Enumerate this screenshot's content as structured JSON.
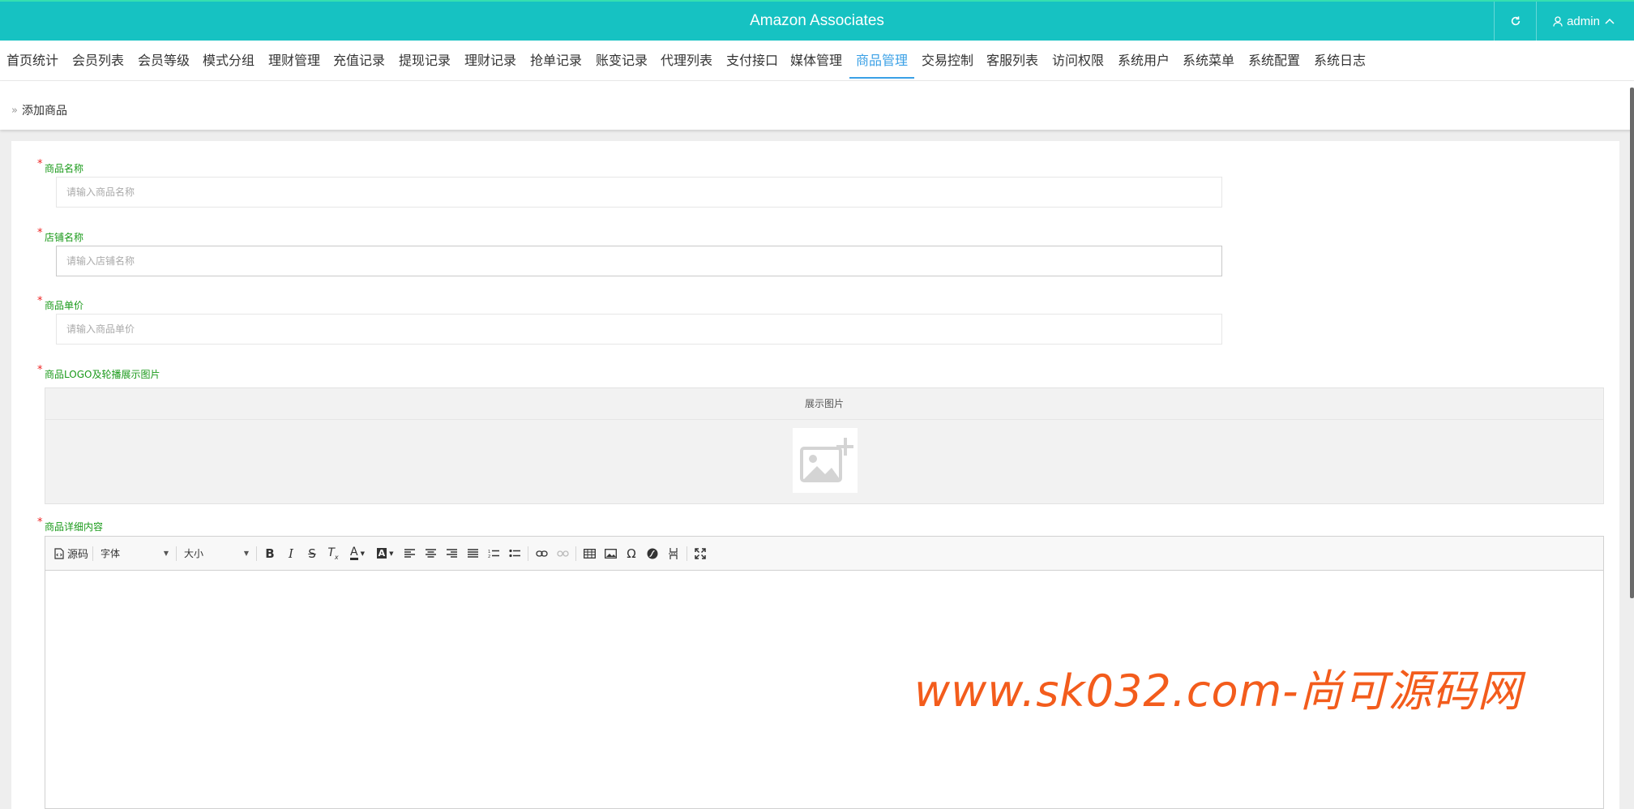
{
  "header": {
    "title": "Amazon Associates",
    "user_label": "admin",
    "colors": {
      "bar": "#16c2c2",
      "accent": "#3aa0e6"
    }
  },
  "nav": {
    "active_index": 13,
    "items": [
      "首页统计",
      "会员列表",
      "会员等级",
      "模式分组",
      "理财管理",
      "充值记录",
      "提现记录",
      "理财记录",
      "抢单记录",
      "账变记录",
      "代理列表",
      "支付接口",
      "媒体管理",
      "商品管理",
      "交易控制",
      "客服列表",
      "访问权限",
      "系统用户",
      "系统菜单",
      "系统配置",
      "系统日志"
    ]
  },
  "breadcrumb": {
    "label": "添加商品"
  },
  "form": {
    "name_label": "商品名称",
    "name_placeholder": "请输入商品名称",
    "shop_label": "店铺名称",
    "shop_placeholder": "请输入店铺名称",
    "price_label": "商品单价",
    "price_placeholder": "请输入商品单价",
    "image_label": "商品LOGO及轮播展示图片",
    "image_header": "展示图片",
    "detail_label": "商品详细内容"
  },
  "editor": {
    "source_label": "源码",
    "font_label": "字体",
    "size_label": "大小",
    "tools": [
      "bold-icon",
      "italic-icon",
      "strikethrough-icon",
      "remove-format-icon",
      "text-color-icon",
      "bg-color-icon",
      "align-left-icon",
      "align-center-icon",
      "align-right-icon",
      "justify-icon",
      "numbered-list-icon",
      "bulleted-list-icon",
      "link-icon",
      "unlink-icon",
      "table-icon",
      "image-icon",
      "special-char-icon",
      "flash-icon",
      "page-break-icon",
      "maximize-icon"
    ]
  },
  "watermark": {
    "text": "www.sk032.com-尚可源码网"
  }
}
